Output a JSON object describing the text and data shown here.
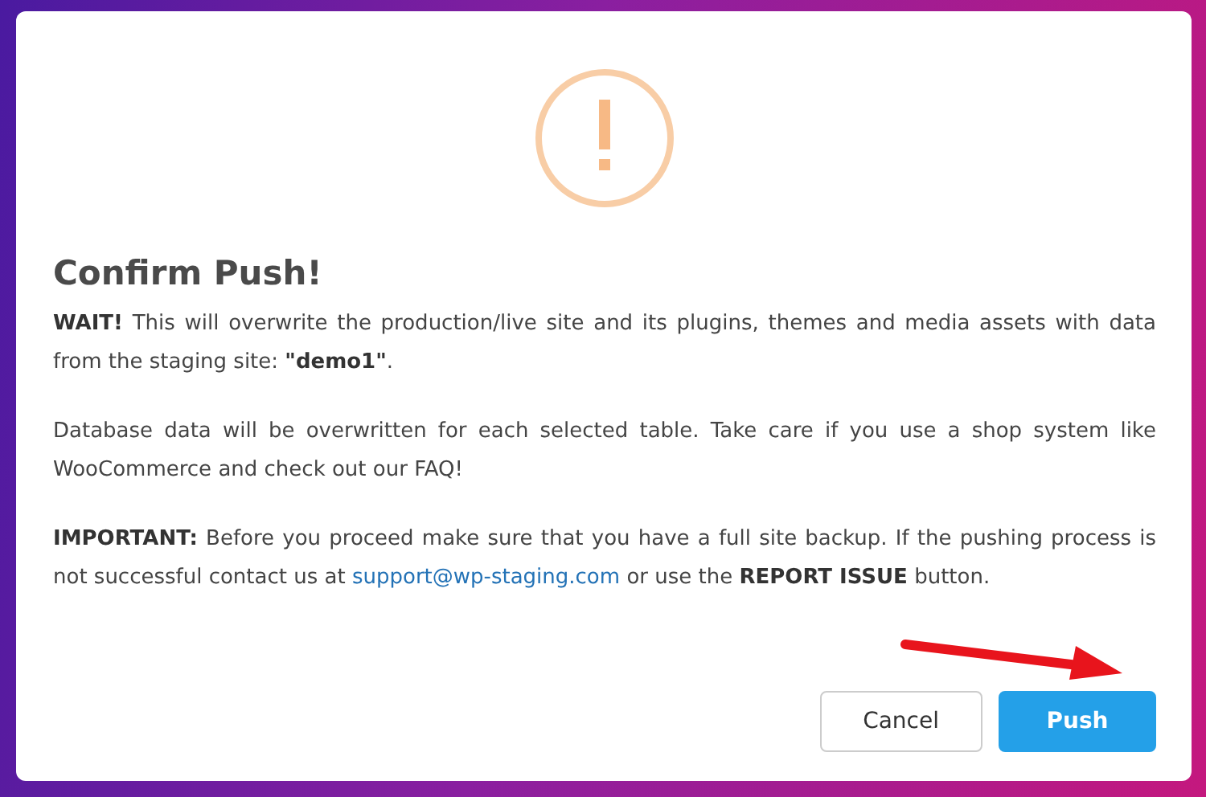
{
  "dialog": {
    "title": "Confirm Push!",
    "paragraphs": [
      {
        "text": "**WAIT!** This will overwrite the production/live site and its plugins, themes and media assets with data from the staging site: **\"demo1\"**."
      },
      {
        "text": "Database data will be overwritten for each selected table. Take care if you use a shop system like WooCommerce and check out our FAQ!"
      },
      {
        "text": "**IMPORTANT:** Before you proceed make sure that you have a full site backup. If the pushing process is not successful contact us at",
        "link": "support@wp-staging.com",
        "after": "or use the **REPORT ISSUE** button."
      }
    ],
    "buttons": [
      {
        "label": "Cancel",
        "kind": "secondary"
      },
      {
        "label": "Push",
        "kind": "primary"
      }
    ]
  }
}
